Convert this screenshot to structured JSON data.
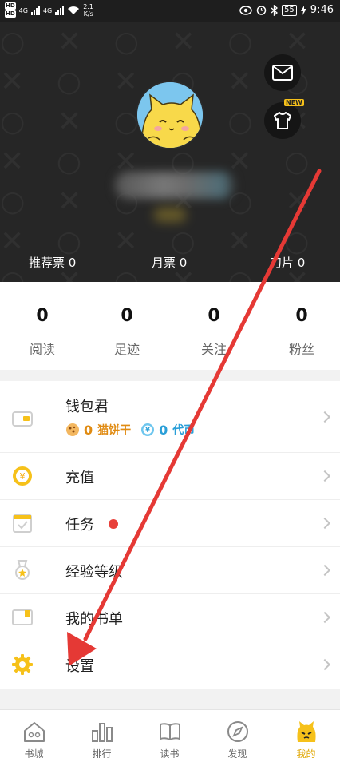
{
  "status_bar": {
    "hd1": "HD",
    "hd2": "HD",
    "net1": "4G",
    "net2": "4G",
    "speed": "2.1",
    "speed_unit": "K/s",
    "battery": "55",
    "time": "9:46"
  },
  "header": {
    "new_badge": "NEW",
    "tickets": [
      {
        "label": "推荐票 0"
      },
      {
        "label": "月票 0"
      },
      {
        "label": "刀片 0"
      }
    ]
  },
  "stats": [
    {
      "value": "0",
      "label": "阅读"
    },
    {
      "value": "0",
      "label": "足迹"
    },
    {
      "value": "0",
      "label": "关注"
    },
    {
      "value": "0",
      "label": "粉丝"
    }
  ],
  "menu": {
    "wallet": {
      "title": "钱包君",
      "biscuit_count": "0",
      "biscuit_label": "猫饼干",
      "coin_count": "0",
      "coin_label": "代币"
    },
    "recharge": "充值",
    "tasks": "任务",
    "level": "经验等级",
    "booklist": "我的书单",
    "settings": "设置"
  },
  "tabs": [
    {
      "label": "书城"
    },
    {
      "label": "排行"
    },
    {
      "label": "读书"
    },
    {
      "label": "发现"
    },
    {
      "label": "我的"
    }
  ],
  "colors": {
    "accent": "#f6c11a",
    "arrow": "#e53935",
    "header_bg": "#262626",
    "biscuit": "#e08b12",
    "coin": "#2a9fd8"
  }
}
